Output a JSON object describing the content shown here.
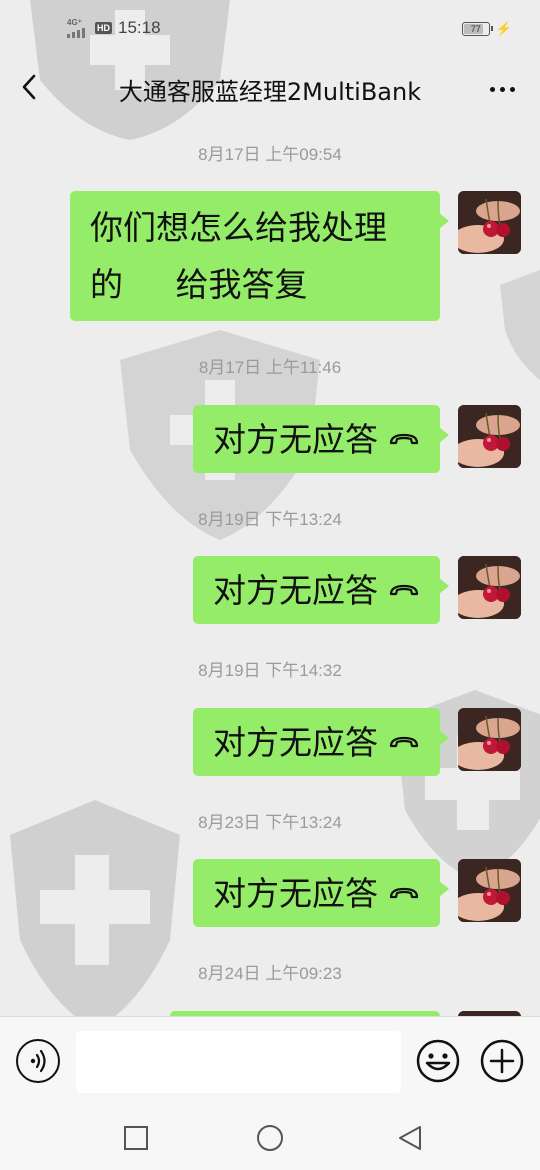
{
  "status_bar": {
    "network": "4G⁺",
    "hd_badge": "HD",
    "time": "15:18",
    "battery": "77"
  },
  "header": {
    "title": "大通客服蓝经理2MultiBank"
  },
  "messages": [
    {
      "timestamp": "8月17日 上午09:54",
      "text": "你们想怎么给我处理\n的     给我答复",
      "is_call": false
    },
    {
      "timestamp": "8月17日 上午11:46",
      "text": "对方无应答",
      "is_call": true
    },
    {
      "timestamp": "8月19日 下午13:24",
      "text": "对方无应答",
      "is_call": true
    },
    {
      "timestamp": "8月19日 下午14:32",
      "text": "对方无应答",
      "is_call": true
    },
    {
      "timestamp": "8月23日 下午13:24",
      "text": "对方无应答",
      "is_call": true
    },
    {
      "timestamp": "8月24日 上午09:23",
      "text": "",
      "is_call": false
    }
  ],
  "input": {
    "value": "",
    "placeholder": ""
  },
  "colors": {
    "bubble": "#95ec69",
    "background": "#ededed",
    "input_bar": "#f7f7f7"
  },
  "icons": {
    "back": "chevron-left-icon",
    "more": "more-dots-icon",
    "voice": "voice-icon",
    "emoji": "emoji-icon",
    "plus": "plus-icon",
    "call": "phone-hangup-icon",
    "nav_recent": "square-icon",
    "nav_home": "circle-icon",
    "nav_back": "triangle-back-icon"
  }
}
